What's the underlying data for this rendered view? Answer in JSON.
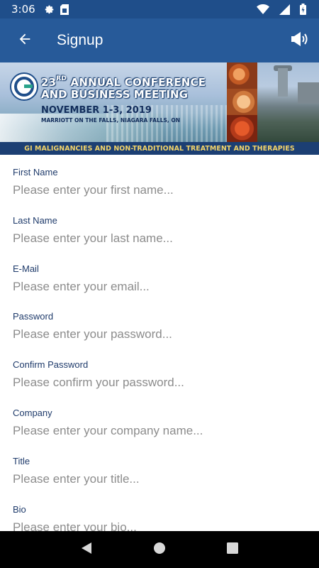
{
  "status_bar": {
    "time": "3:06",
    "icons": [
      "gear-icon",
      "sim-card-icon",
      "wifi-icon",
      "signal-icon",
      "battery-icon"
    ]
  },
  "app_bar": {
    "title": "Signup",
    "back_icon": "arrow-left-icon",
    "action_icon": "megaphone-icon"
  },
  "banner": {
    "line1_ordinal": "23",
    "line1_suffix": "RD",
    "line1_rest": " ANNUAL CONFERENCE",
    "line2": "AND BUSINESS MEETING",
    "date": "NOVEMBER 1-3, 2019",
    "venue": "MARRIOTT ON THE FALLS, NIAGARA FALLS, ON",
    "tagline": "GI MALIGNANCIES AND NON-TRADITIONAL TREATMENT AND THERAPIES"
  },
  "form": {
    "fields": [
      {
        "label": "First Name",
        "placeholder": "Please enter your first name...",
        "value": ""
      },
      {
        "label": "Last Name",
        "placeholder": "Please enter your last name...",
        "value": ""
      },
      {
        "label": "E-Mail",
        "placeholder": "Please enter your email...",
        "value": ""
      },
      {
        "label": "Password",
        "placeholder": "Please enter your password...",
        "value": ""
      },
      {
        "label": "Confirm Password",
        "placeholder": "Please confirm your password...",
        "value": ""
      },
      {
        "label": "Company",
        "placeholder": "Please enter your company name...",
        "value": ""
      },
      {
        "label": "Title",
        "placeholder": "Please enter your title...",
        "value": ""
      },
      {
        "label": "Bio",
        "placeholder": "Please enter your bio...",
        "value": ""
      }
    ]
  },
  "nav_bar": {
    "icons": [
      "back-triangle-icon",
      "home-circle-icon",
      "recents-square-icon"
    ]
  },
  "colors": {
    "status_bar": "#1f4e8a",
    "app_bar": "#275a99",
    "label": "#1f3b6b",
    "placeholder": "#8c8c8c",
    "banner_strip": "#1c3f73",
    "banner_tagline": "#f3d46a"
  }
}
